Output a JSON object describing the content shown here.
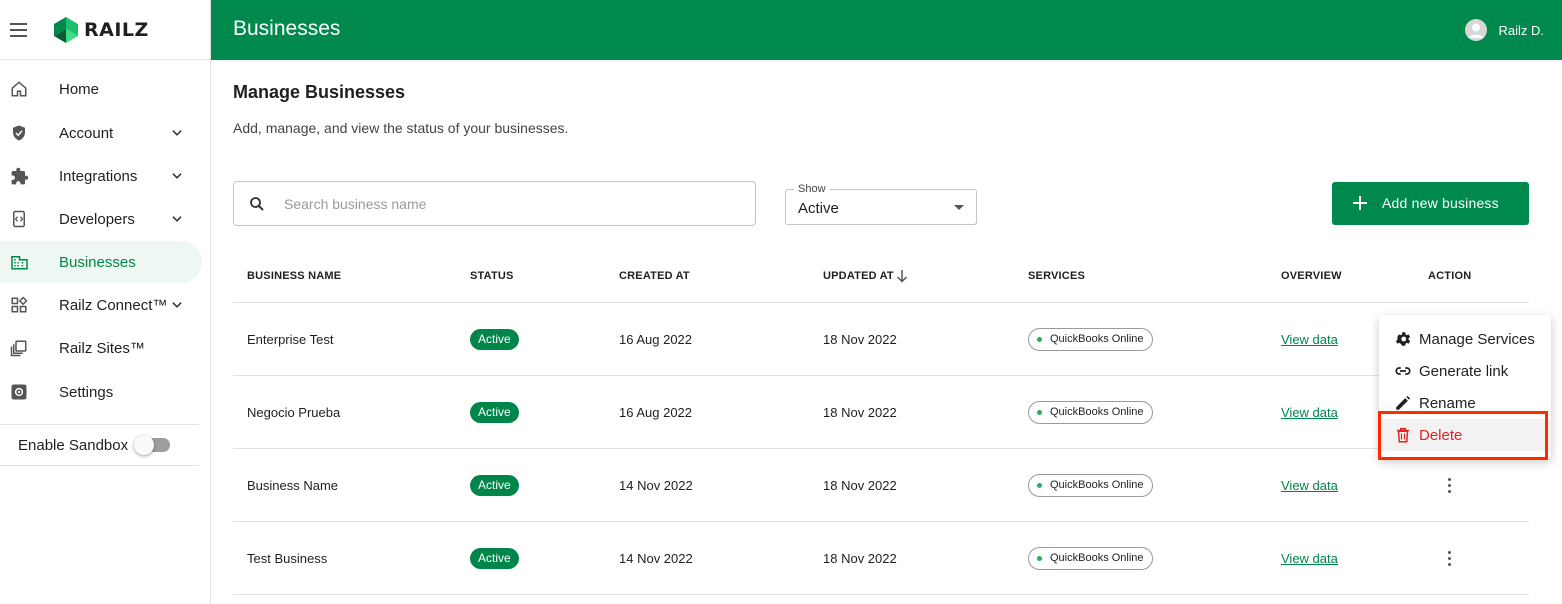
{
  "brand": {
    "logo_text": "RAILZ"
  },
  "header": {
    "title": "Businesses",
    "user_name": "Railz D."
  },
  "sidebar": {
    "items": [
      {
        "label": "Home",
        "icon": "home-icon",
        "chevron": false
      },
      {
        "label": "Account",
        "icon": "shield-icon",
        "chevron": true
      },
      {
        "label": "Integrations",
        "icon": "puzzle-icon",
        "chevron": true
      },
      {
        "label": "Developers",
        "icon": "code-icon",
        "chevron": true
      },
      {
        "label": "Businesses",
        "icon": "building-icon",
        "chevron": false,
        "active": true
      },
      {
        "label": "Railz Connect™",
        "icon": "widgets-icon",
        "chevron": true
      },
      {
        "label": "Railz Sites™",
        "icon": "library-icon",
        "chevron": false
      },
      {
        "label": "Settings",
        "icon": "settings-icon",
        "chevron": false
      }
    ],
    "sandbox_label": "Enable Sandbox",
    "sandbox_enabled": false
  },
  "main": {
    "title": "Manage Businesses",
    "subtitle": "Add, manage, and view the status of your businesses.",
    "search_placeholder": "Search business name",
    "show_label": "Show",
    "show_value": "Active",
    "add_button_label": "Add new business"
  },
  "table": {
    "headers": {
      "name": "BUSINESS NAME",
      "status": "STATUS",
      "created": "CREATED AT",
      "updated": "UPDATED AT",
      "services": "SERVICES",
      "overview": "OVERVIEW",
      "action": "ACTION"
    },
    "rows": [
      {
        "name": "Enterprise Test",
        "status": "Active",
        "created": "16 Aug 2022",
        "updated": "18 Nov 2022",
        "service": "QuickBooks Online",
        "overview": "View data"
      },
      {
        "name": "Negocio Prueba",
        "status": "Active",
        "created": "16 Aug 2022",
        "updated": "18 Nov 2022",
        "service": "QuickBooks Online",
        "overview": "View data"
      },
      {
        "name": "Business Name",
        "status": "Active",
        "created": "14 Nov 2022",
        "updated": "18 Nov 2022",
        "service": "QuickBooks Online",
        "overview": "View data"
      },
      {
        "name": "Test Business",
        "status": "Active",
        "created": "14 Nov 2022",
        "updated": "18 Nov 2022",
        "service": "QuickBooks Online",
        "overview": "View data"
      }
    ]
  },
  "action_menu": {
    "items": [
      {
        "label": "Manage Services",
        "icon": "gear-icon"
      },
      {
        "label": "Generate link",
        "icon": "link-icon"
      },
      {
        "label": "Rename",
        "icon": "pencil-icon"
      },
      {
        "label": "Delete",
        "icon": "trash-icon"
      }
    ]
  },
  "colors": {
    "brand_green": "#00894d",
    "delete_red": "#e02424",
    "highlight": "#ff2a00"
  }
}
